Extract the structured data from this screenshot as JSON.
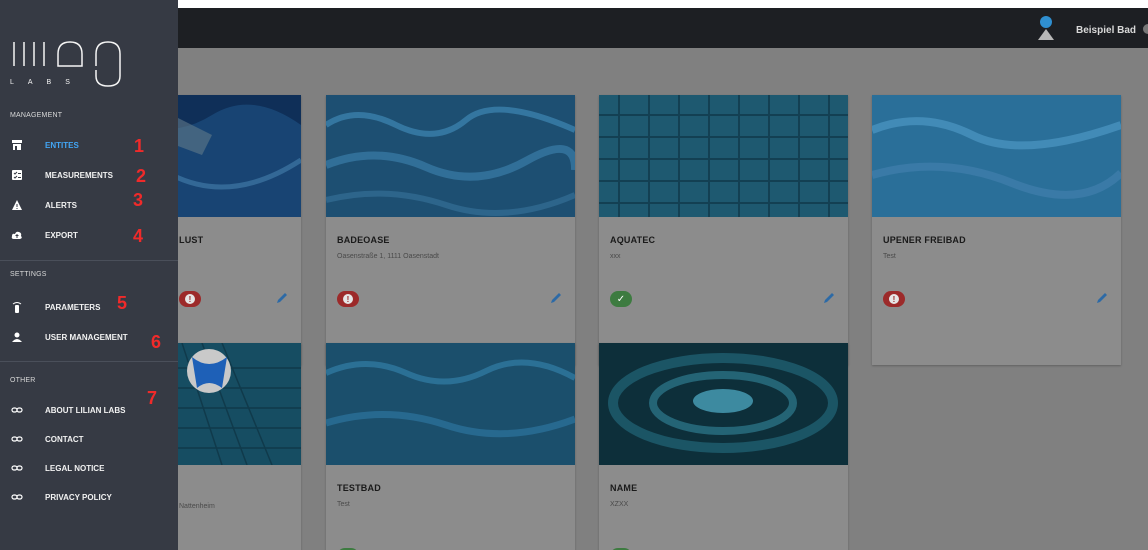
{
  "header": {
    "user_name": "Beispiel Bad"
  },
  "sidebar": {
    "logo": {
      "name": "lilian",
      "sub": "L A B S"
    },
    "sections": {
      "management": "MANAGEMENT",
      "settings": "SETTINGS",
      "other": "OTHER"
    },
    "items": [
      {
        "label": "ENTITES",
        "icon": "store-icon",
        "active": true,
        "number": "1"
      },
      {
        "label": "MEASUREMENTS",
        "icon": "checklist-icon",
        "number": "2"
      },
      {
        "label": "ALERTS",
        "icon": "warning-icon",
        "number": "3"
      },
      {
        "label": "EXPORT",
        "icon": "cloud-upload-icon",
        "number": "4"
      },
      {
        "label": "PARAMETERS",
        "icon": "remote-icon",
        "number": "5"
      },
      {
        "label": "USER MANAGEMENT",
        "icon": "person-icon",
        "number": "6"
      },
      {
        "label": "ABOUT LILIAN LABS",
        "icon": "link-icon",
        "number": "7"
      },
      {
        "label": "CONTACT",
        "icon": "link-icon"
      },
      {
        "label": "LEGAL NOTICE",
        "icon": "link-icon"
      },
      {
        "label": "PRIVACY POLICY",
        "icon": "link-icon"
      }
    ]
  },
  "cards": [
    {
      "name": "LUST",
      "sub": "",
      "status": "alert"
    },
    {
      "name": "BADEOASE",
      "sub": "Oasenstraße 1, 1111 Oasenstadt",
      "status": "alert"
    },
    {
      "name": "AQUATEC",
      "sub": "xxx",
      "status": "ok"
    },
    {
      "name": "UPENER FREIBAD",
      "sub": "Test",
      "status": "alert"
    },
    {
      "name": "",
      "sub": "Nattenheim",
      "status": ""
    },
    {
      "name": "TESTBAD",
      "sub": "Test",
      "status": "ok"
    },
    {
      "name": "NAME",
      "sub": "XZXX",
      "status": "ok"
    }
  ],
  "colors": {
    "accent": "#42a5f5",
    "sidebar": "#363a44",
    "alert": "#9c2a2a",
    "ok": "#3d7b40",
    "number": "#f02a2a"
  }
}
